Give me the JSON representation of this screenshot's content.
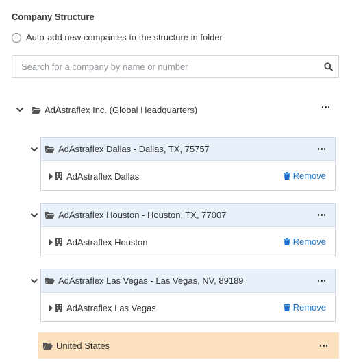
{
  "header": {
    "title": "Company Structure"
  },
  "auto_add": {
    "label": "Auto-add new companies to the structure in folder"
  },
  "search": {
    "placeholder": "Search for a company by name or number",
    "value": ""
  },
  "root": {
    "label": "AdAstraflex Inc. (Global Headquarters)"
  },
  "groups": [
    {
      "folder_label": "AdAstraflex Dallas - Dallas, TX, 75757",
      "company": "AdAstraflex Dallas",
      "remove_label": "Remove"
    },
    {
      "folder_label": "AdAstraflex Houston - Houston, TX, 77007",
      "company": "AdAstraflex Houston",
      "remove_label": "Remove"
    },
    {
      "folder_label": "AdAstraflex Las Vegas - Las Vegas, NV, 89189",
      "company": "AdAstraflex Las Vegas",
      "remove_label": "Remove"
    }
  ],
  "new_folder": {
    "label": "United States",
    "highlight_color": "#fbe1bd"
  },
  "colors": {
    "accent": "#1a73c9",
    "card_header": "#e8f0fa"
  },
  "icons": {
    "chevron": "chevron-down-icon",
    "folder": "folder-open-icon",
    "more": "more-horizontal-icon",
    "caret": "caret-right-icon",
    "building": "building-icon",
    "trash": "trash-icon",
    "search": "search-icon"
  }
}
